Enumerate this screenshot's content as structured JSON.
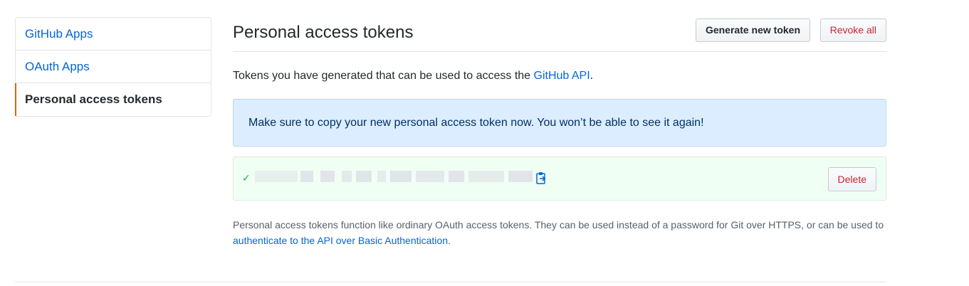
{
  "sidebar": {
    "items": [
      {
        "label": "GitHub Apps"
      },
      {
        "label": "OAuth Apps"
      },
      {
        "label": "Personal access tokens"
      }
    ]
  },
  "header": {
    "title": "Personal access tokens",
    "generate_label": "Generate new token",
    "revoke_label": "Revoke all"
  },
  "intro": {
    "text_before": "Tokens you have generated that can be used to access the ",
    "link": "GitHub API",
    "text_after": "."
  },
  "flash": {
    "message": "Make sure to copy your new personal access token now. You won’t be able to see it again!"
  },
  "token": {
    "delete_label": "Delete"
  },
  "note": {
    "text_before": "Personal access tokens function like ordinary OAuth access tokens. They can be used instead of a password for Git over HTTPS, or can be used to ",
    "link": "authenticate to the API over Basic Authentication",
    "text_after": "."
  },
  "colors": {
    "link": "#0366d6",
    "danger": "#cb2431",
    "success": "#28a745",
    "flash_bg": "#dbedff",
    "token_bg": "#f0fff4",
    "selected_marker": "#e36209"
  },
  "icons": {
    "check": "check-icon",
    "clipboard": "clipboard-icon"
  }
}
